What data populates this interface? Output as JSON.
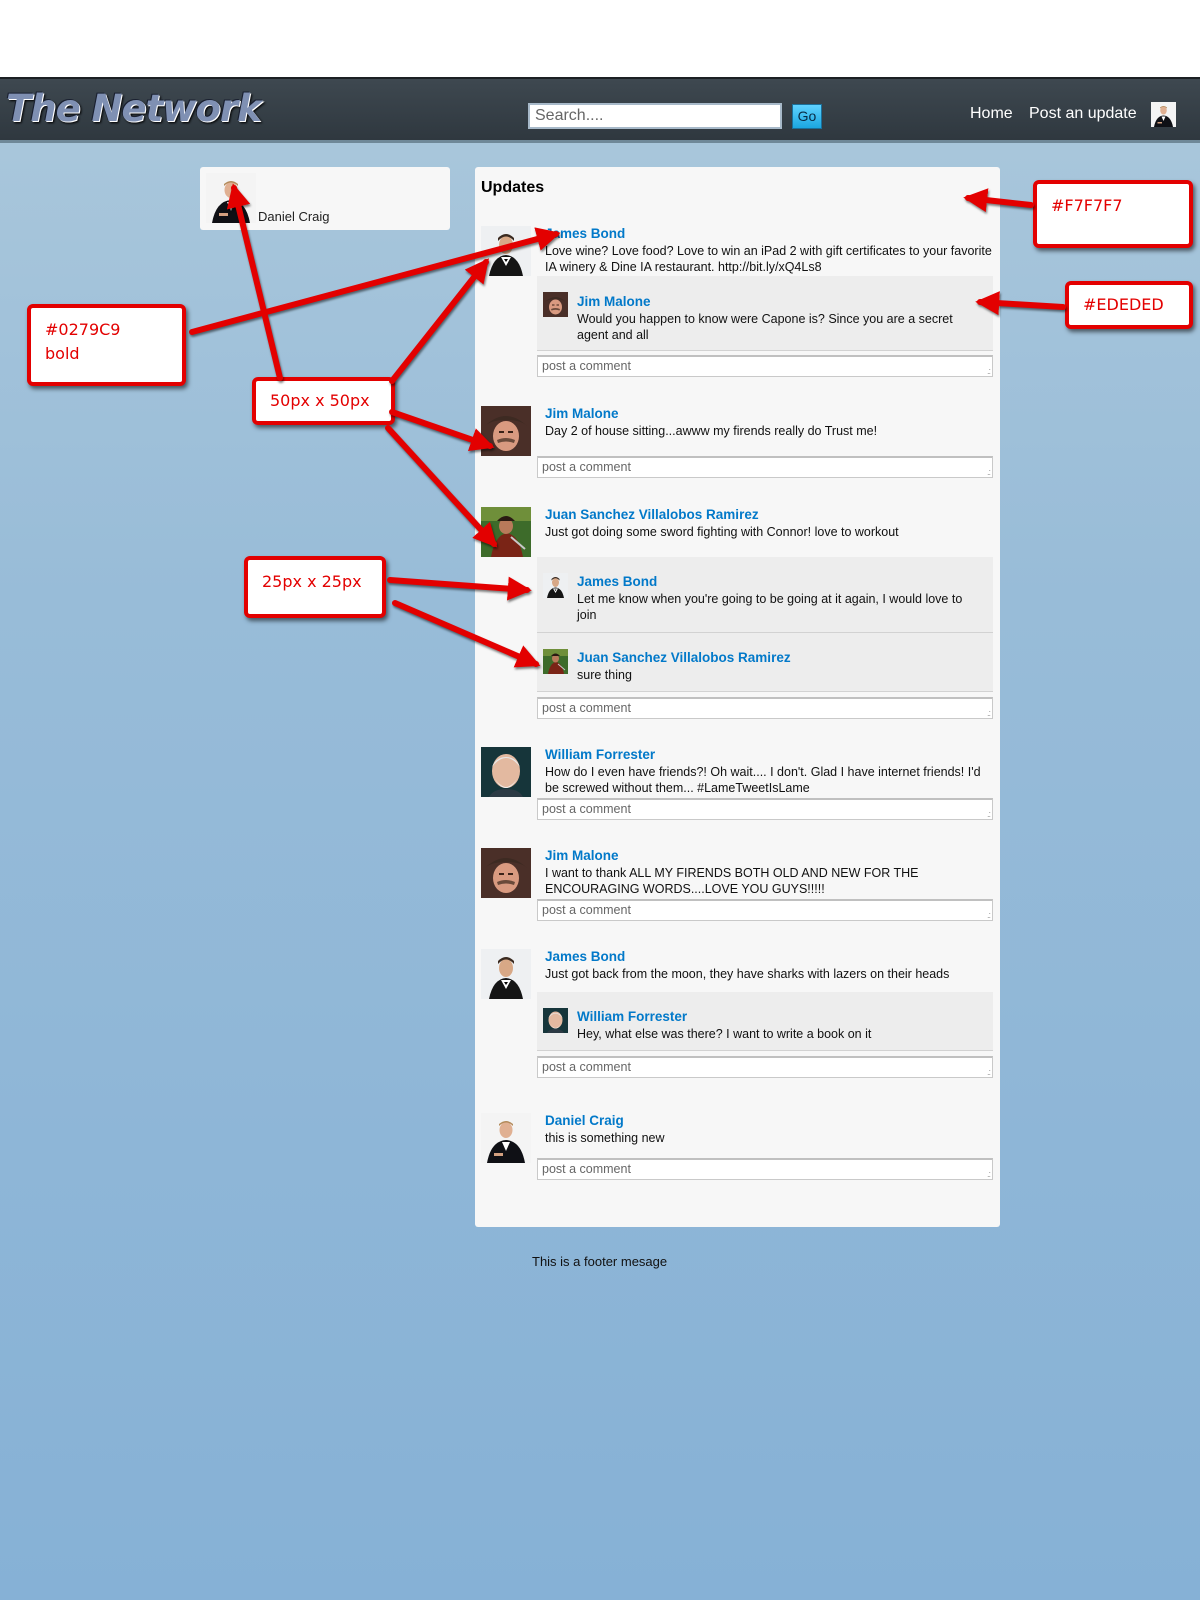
{
  "header": {
    "logo": "The Network",
    "search_placeholder": "Search....",
    "go_label": "Go",
    "nav": [
      "Home",
      "Post an update"
    ]
  },
  "profile": {
    "name": "Daniel Craig"
  },
  "updates": {
    "title": "Updates",
    "comment_placeholder": "post a comment",
    "posts": [
      {
        "author": "James Bond",
        "text": "Love wine? Love food? Love to win an iPad 2 with gift certificates to your favorite IA winery & Dine IA restaurant. http://bit.ly/xQ4Ls8",
        "comments": [
          {
            "author": "Jim Malone",
            "text": "Would you happen to know were Capone is? Since you are a secret agent and all"
          }
        ]
      },
      {
        "author": "Jim Malone",
        "text": "Day 2 of house sitting...awww my firends really do Trust me!",
        "comments": []
      },
      {
        "author": "Juan Sanchez Villalobos Ramirez",
        "text": "Just got doing some sword fighting with Connor! love to workout",
        "comments": [
          {
            "author": "James Bond",
            "text": "Let me know when you're going to be going at it again, I would love to join"
          },
          {
            "author": "Juan Sanchez Villalobos Ramirez",
            "text": "sure thing"
          }
        ]
      },
      {
        "author": "William Forrester",
        "text": "How do I even have friends?! Oh wait.... I don't. Glad I have internet friends! I'd be screwed without them... #LameTweetIsLame",
        "comments": []
      },
      {
        "author": "Jim Malone",
        "text": "I want to thank ALL MY FIRENDS BOTH OLD AND NEW FOR THE ENCOURAGING WORDS....LOVE YOU GUYS!!!!!",
        "comments": []
      },
      {
        "author": "James Bond",
        "text": "Just got back from the moon, they have sharks with lazers on their heads",
        "comments": [
          {
            "author": "William Forrester",
            "text": "Hey, what else was there? I want to write a book on it"
          }
        ]
      },
      {
        "author": "Daniel Craig",
        "text": "this is something new",
        "comments": []
      }
    ]
  },
  "footer": "This is a footer mesage",
  "annotations": {
    "bg_color": "#F7F7F7",
    "comment_bg": "#EDEDED",
    "author_style": [
      "#0279C9",
      "bold"
    ],
    "avatar_large": "50px  x 50px",
    "avatar_small": "25px x 25px"
  },
  "colors": {
    "link": "#0279C9",
    "panel": "#F7F7F7",
    "comment": "#EDEDED",
    "annotation": "#e30000"
  },
  "icons": {
    "avatar": "person-avatar-icon",
    "resize": "textarea-resize-icon"
  }
}
